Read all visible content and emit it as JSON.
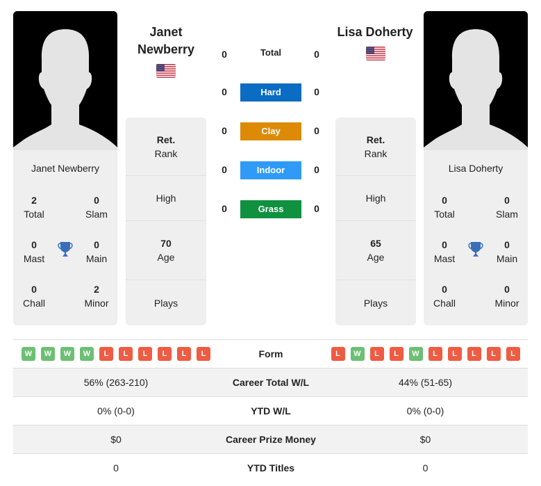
{
  "player1": {
    "name": "Janet Newberry",
    "name_line1": "Janet",
    "name_line2": "Newberry",
    "country_flag": "us-flag-icon",
    "titles": {
      "total": {
        "value": "2",
        "label": "Total"
      },
      "slam": {
        "value": "0",
        "label": "Slam"
      },
      "mast": {
        "value": "0",
        "label": "Mast"
      },
      "main": {
        "value": "0",
        "label": "Main"
      },
      "chall": {
        "value": "0",
        "label": "Chall"
      },
      "minor": {
        "value": "2",
        "label": "Minor"
      }
    },
    "rank": {
      "value": "Ret.",
      "label": "Rank"
    },
    "high": {
      "value": "",
      "label": "High"
    },
    "age": {
      "value": "70",
      "label": "Age"
    },
    "plays": {
      "value": "",
      "label": "Plays"
    },
    "form": [
      "W",
      "W",
      "W",
      "W",
      "L",
      "L",
      "L",
      "L",
      "L",
      "L"
    ],
    "career_total_wl": "56% (263-210)",
    "ytd_wl": "0% (0-0)",
    "career_prize_money": "$0",
    "ytd_titles": "0"
  },
  "player2": {
    "name": "Lisa Doherty",
    "country_flag": "us-flag-icon",
    "titles": {
      "total": {
        "value": "0",
        "label": "Total"
      },
      "slam": {
        "value": "0",
        "label": "Slam"
      },
      "mast": {
        "value": "0",
        "label": "Mast"
      },
      "main": {
        "value": "0",
        "label": "Main"
      },
      "chall": {
        "value": "0",
        "label": "Chall"
      },
      "minor": {
        "value": "0",
        "label": "Minor"
      }
    },
    "rank": {
      "value": "Ret.",
      "label": "Rank"
    },
    "high": {
      "value": "",
      "label": "High"
    },
    "age": {
      "value": "65",
      "label": "Age"
    },
    "plays": {
      "value": "",
      "label": "Plays"
    },
    "form": [
      "L",
      "W",
      "L",
      "L",
      "W",
      "L",
      "L",
      "L",
      "L",
      "L"
    ],
    "career_total_wl": "44% (51-65)",
    "ytd_wl": "0% (0-0)",
    "career_prize_money": "$0",
    "ytd_titles": "0"
  },
  "h2h": {
    "total": {
      "label": "Total",
      "p1": "0",
      "p2": "0"
    },
    "surfaces": [
      {
        "label": "Hard",
        "p1": "0",
        "p2": "0",
        "color": "#0a6cc2"
      },
      {
        "label": "Clay",
        "p1": "0",
        "p2": "0",
        "color": "#dd8a06"
      },
      {
        "label": "Indoor",
        "p1": "0",
        "p2": "0",
        "color": "#2f9bf7"
      },
      {
        "label": "Grass",
        "p1": "0",
        "p2": "0",
        "color": "#0f9140"
      }
    ]
  },
  "table": {
    "form_label": "Form",
    "career_total_wl_label": "Career Total W/L",
    "ytd_wl_label": "YTD W/L",
    "career_prize_money_label": "Career Prize Money",
    "ytd_titles_label": "YTD Titles"
  },
  "colors": {
    "win": "#6cbf73",
    "loss": "#ef5b43",
    "trophy": "#3a6fb8"
  }
}
